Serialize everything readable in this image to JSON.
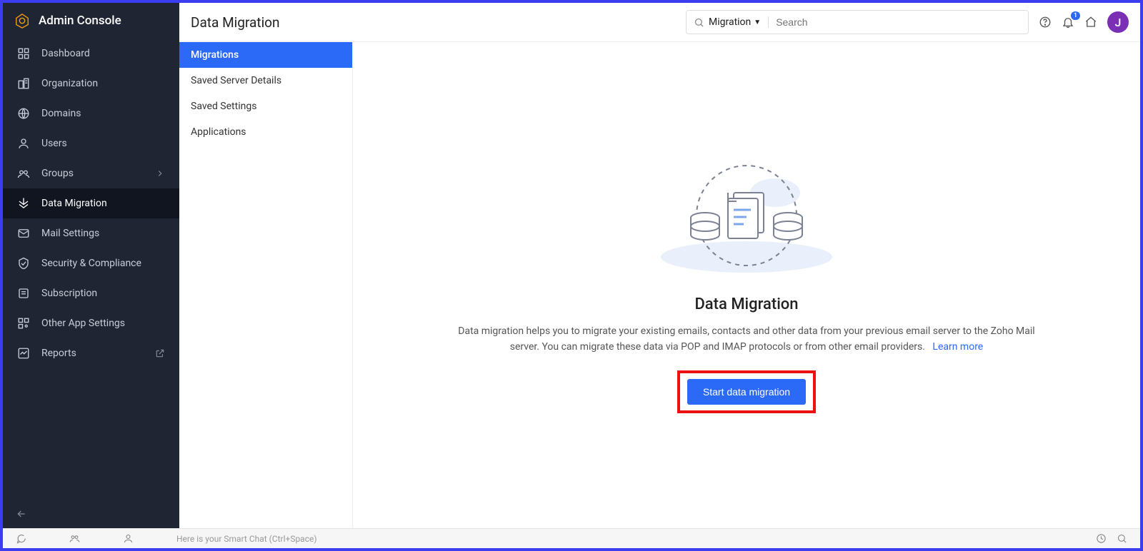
{
  "brand": {
    "title": "Admin Console"
  },
  "sidebar": {
    "items": [
      {
        "label": "Dashboard",
        "active": false
      },
      {
        "label": "Organization",
        "active": false
      },
      {
        "label": "Domains",
        "active": false
      },
      {
        "label": "Users",
        "active": false
      },
      {
        "label": "Groups",
        "active": false,
        "chevron": true
      },
      {
        "label": "Data Migration",
        "active": true
      },
      {
        "label": "Mail Settings",
        "active": false
      },
      {
        "label": "Security & Compliance",
        "active": false
      },
      {
        "label": "Subscription",
        "active": false
      },
      {
        "label": "Other App Settings",
        "active": false
      },
      {
        "label": "Reports",
        "active": false,
        "external": true
      }
    ]
  },
  "subnav": {
    "items": [
      {
        "label": "Migrations",
        "active": true
      },
      {
        "label": "Saved Server Details",
        "active": false
      },
      {
        "label": "Saved Settings",
        "active": false
      },
      {
        "label": "Applications",
        "active": false
      }
    ]
  },
  "header": {
    "title": "Data Migration",
    "search_scope": "Migration",
    "search_placeholder": "Search",
    "notification_badge": "1",
    "avatar_initial": "J"
  },
  "main": {
    "title": "Data Migration",
    "description": "Data migration helps you to migrate your existing emails, contacts and other data from your previous email server to the Zoho Mail server. You can migrate these data via POP and IMAP protocols or from other email providers.",
    "learn_more": "Learn more",
    "cta": "Start data migration"
  },
  "bottombar": {
    "smartchat": "Here is your Smart Chat (Ctrl+Space)"
  }
}
